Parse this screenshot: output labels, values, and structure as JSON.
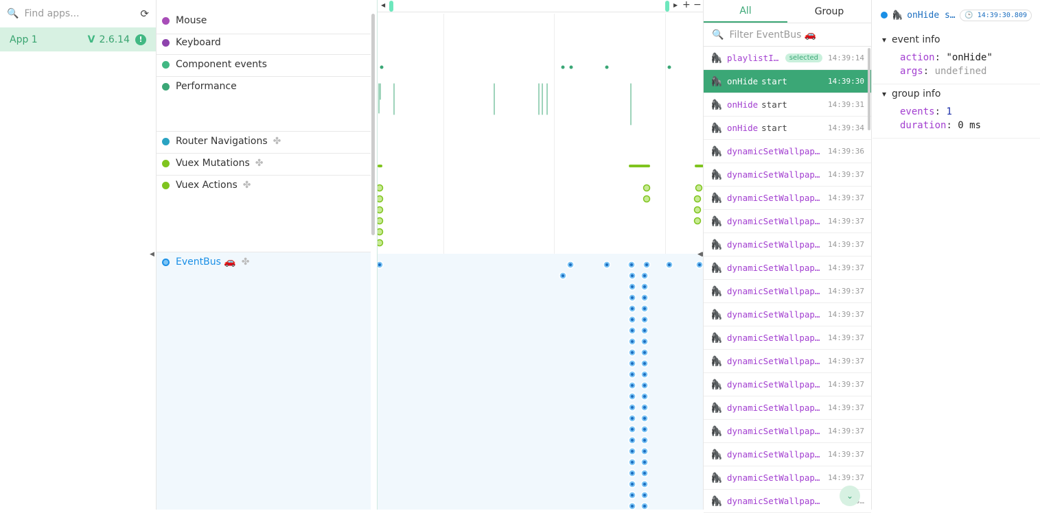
{
  "apps": {
    "search_placeholder": "Find apps...",
    "items": [
      {
        "name": "App 1",
        "version": "2.6.14"
      }
    ]
  },
  "layers": [
    {
      "label": "Mouse",
      "color": "#a84db8"
    },
    {
      "label": "Keyboard",
      "color": "#8e44ad"
    },
    {
      "label": "Component events",
      "color": "#41b883"
    },
    {
      "label": "Performance",
      "color": "#3ba776"
    },
    {
      "label": "Router Navigations",
      "color": "#2aa3c2"
    },
    {
      "label": "Vuex Mutations",
      "color": "#7fc41f"
    },
    {
      "label": "Vuex Actions",
      "color": "#7fc41f"
    },
    {
      "label": "EventBus 🚗",
      "color": "#1a8fe6"
    }
  ],
  "events_panel": {
    "tabs": [
      "All",
      "Group"
    ],
    "filter_placeholder": "Filter EventBus 🚗",
    "selected_label": "selected",
    "items": [
      {
        "name": "playlistI…",
        "suffix": "",
        "time": "14:39:14",
        "selected_badge": true
      },
      {
        "name": "onHide",
        "suffix": "start",
        "time": "14:39:30",
        "selected": true
      },
      {
        "name": "onHide",
        "suffix": "start",
        "time": "14:39:31"
      },
      {
        "name": "onHide",
        "suffix": "start",
        "time": "14:39:34"
      },
      {
        "name": "dynamicSetWallpap…",
        "suffix": "",
        "time": "14:39:36"
      },
      {
        "name": "dynamicSetWallpap…",
        "suffix": "",
        "time": "14:39:37"
      },
      {
        "name": "dynamicSetWallpap…",
        "suffix": "",
        "time": "14:39:37"
      },
      {
        "name": "dynamicSetWallpap…",
        "suffix": "",
        "time": "14:39:37"
      },
      {
        "name": "dynamicSetWallpap…",
        "suffix": "",
        "time": "14:39:37"
      },
      {
        "name": "dynamicSetWallpap…",
        "suffix": "",
        "time": "14:39:37"
      },
      {
        "name": "dynamicSetWallpap…",
        "suffix": "",
        "time": "14:39:37"
      },
      {
        "name": "dynamicSetWallpap…",
        "suffix": "",
        "time": "14:39:37"
      },
      {
        "name": "dynamicSetWallpap…",
        "suffix": "",
        "time": "14:39:37"
      },
      {
        "name": "dynamicSetWallpap…",
        "suffix": "",
        "time": "14:39:37"
      },
      {
        "name": "dynamicSetWallpap…",
        "suffix": "",
        "time": "14:39:37"
      },
      {
        "name": "dynamicSetWallpap…",
        "suffix": "",
        "time": "14:39:37"
      },
      {
        "name": "dynamicSetWallpap…",
        "suffix": "",
        "time": "14:39:37"
      },
      {
        "name": "dynamicSetWallpap…",
        "suffix": "",
        "time": "14:39:37"
      },
      {
        "name": "dynamicSetWallpap…",
        "suffix": "",
        "time": "14:39:37"
      },
      {
        "name": "dynamicSetWallpap…",
        "suffix": "",
        "time": "14:3…"
      }
    ]
  },
  "detail": {
    "title": "onHide s…",
    "timestamp": "14:39:30.809",
    "sections": [
      {
        "title": "event info",
        "rows": [
          {
            "key": "action",
            "value": "\"onHide\"",
            "type": "str"
          },
          {
            "key": "args",
            "value": "undefined",
            "type": "undef"
          }
        ]
      },
      {
        "title": "group info",
        "rows": [
          {
            "key": "events",
            "value": "1",
            "type": "num"
          },
          {
            "key": "duration",
            "value": "0 ms",
            "type": "str"
          }
        ]
      }
    ]
  },
  "colors": {
    "accent": "#3ba776",
    "eventbus": "#1a8fe6",
    "vuex": "#7fc41f"
  }
}
